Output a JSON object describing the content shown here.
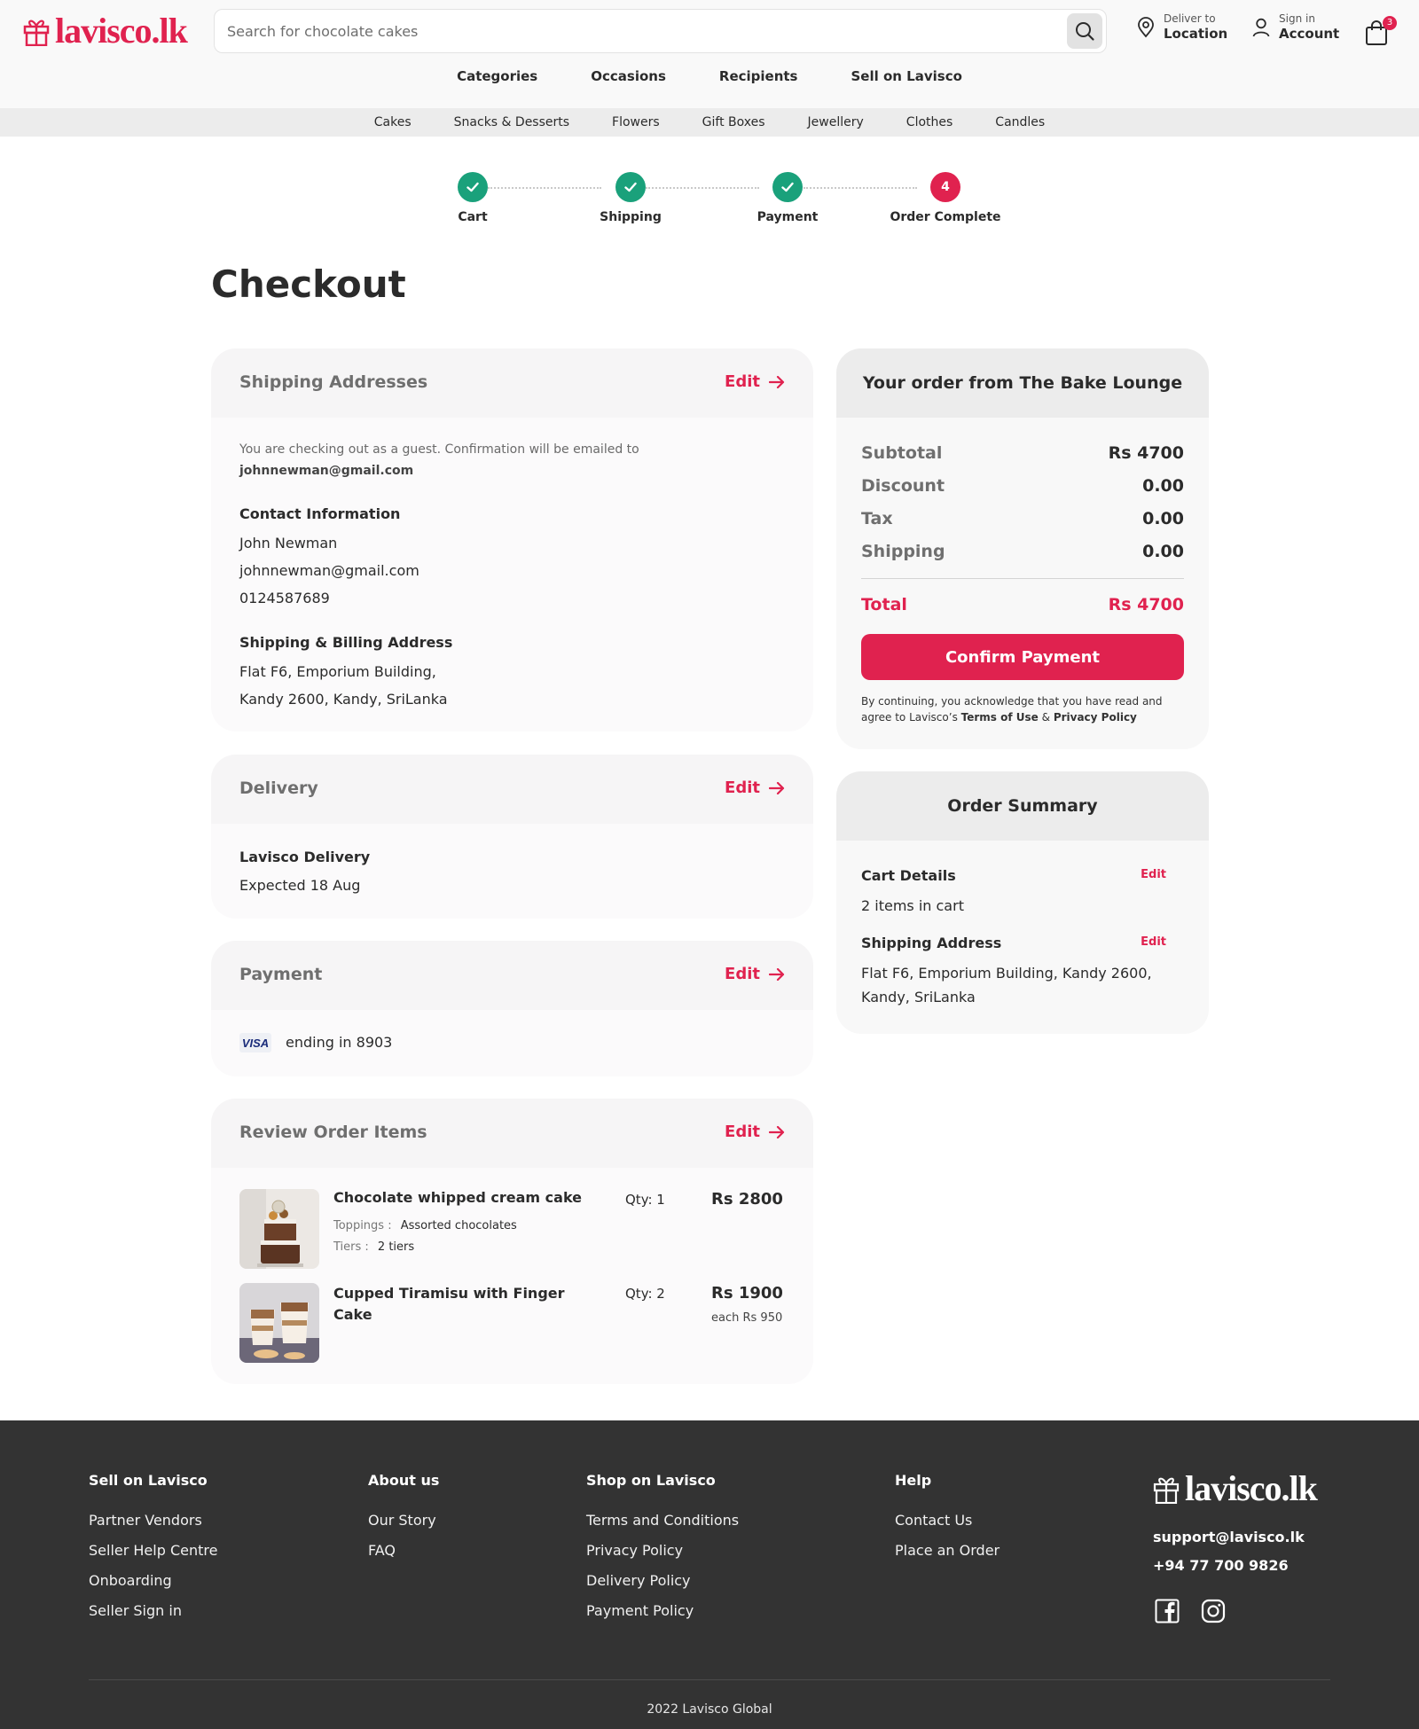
{
  "header": {
    "logo_text": "lavisco.lk",
    "search_placeholder": "Search for chocolate cakes",
    "deliver_small": "Deliver to",
    "deliver_big": "Location",
    "account_small": "Sign in",
    "account_big": "Account",
    "cart_count": "3"
  },
  "main_nav": [
    "Categories",
    "Occasions",
    "Recipients",
    "Sell on Lavisco"
  ],
  "sub_nav": [
    "Cakes",
    "Snacks & Desserts",
    "Flowers",
    "Gift Boxes",
    "Jewellery",
    "Clothes",
    "Candles"
  ],
  "steps": [
    {
      "label": "Cart",
      "state": "done"
    },
    {
      "label": "Shipping",
      "state": "done"
    },
    {
      "label": "Payment",
      "state": "done"
    },
    {
      "label": "Order Complete",
      "state": "current",
      "number": "4"
    }
  ],
  "page_title": "Checkout",
  "edit_label": "Edit",
  "shipping": {
    "title": "Shipping Addresses",
    "guest_note": "You are checking out as a guest. Confirmation will be emailed to",
    "guest_email": "johnnewman@gmail.com",
    "contact_label": "Contact Information",
    "name": "John Newman",
    "email": "johnnewman@gmail.com",
    "phone": "0124587689",
    "address_label": "Shipping & Billing Address",
    "address_line1": "Flat F6, Emporium Building,",
    "address_line2": "Kandy 2600, Kandy, SriLanka"
  },
  "delivery": {
    "title": "Delivery",
    "method": "Lavisco Delivery",
    "expected": "Expected 18 Aug"
  },
  "payment": {
    "title": "Payment",
    "card_brand": "VISA",
    "card_text": "ending in 8903"
  },
  "review": {
    "title": "Review Order Items",
    "items": [
      {
        "name": "Chocolate whipped cream cake",
        "qty": "Qty: 1",
        "price": "Rs 2800",
        "opt1_label": "Toppings :",
        "opt1_value": "Assorted chocolates",
        "opt2_label": "Tiers :",
        "opt2_value": "2 tiers"
      },
      {
        "name_line1": "Cupped Tiramisu with Finger",
        "name_line2": "Cake",
        "qty": "Qty: 2",
        "price": "Rs 1900",
        "each": "each Rs 950"
      }
    ]
  },
  "order": {
    "title": "Your order from The Bake Lounge",
    "subtotal_label": "Subtotal",
    "subtotal": "Rs 4700",
    "discount_label": "Discount",
    "discount": "0.00",
    "tax_label": "Tax",
    "tax": "0.00",
    "shipping_label": "Shipping",
    "shipping": "0.00",
    "total_label": "Total",
    "total": "Rs 4700",
    "confirm_label": "Confirm Payment",
    "legal_1": "By continuing, you acknowledge that you have read and",
    "legal_2": "agree to Lavisco’s",
    "terms": "Terms of Use",
    "amp": "&",
    "privacy": "Privacy Policy"
  },
  "summary": {
    "title": "Order Summary",
    "cart_label": "Cart Details",
    "cart_text": "2 items in cart",
    "address_label": "Shipping Address",
    "address_line1": "Flat F6, Emporium Building, Kandy 2600,",
    "address_line2": "Kandy, SriLanka"
  },
  "footer": {
    "col1_head": "Sell on Lavisco",
    "col1": [
      "Partner Vendors",
      "Seller Help Centre",
      "Onboarding",
      "Seller Sign in"
    ],
    "col2_head": "About us",
    "col2": [
      "Our Story",
      "FAQ"
    ],
    "col3_head": "Shop on Lavisco",
    "col3": [
      "Terms and Conditions",
      "Privacy Policy",
      "Delivery Policy",
      "Payment Policy"
    ],
    "col4_head": "Help",
    "col4": [
      "Contact Us",
      "Place an Order"
    ],
    "logo_text": "lavisco.lk",
    "email": "support@lavisco.lk",
    "phone": "+94 77 700 9826",
    "copyright": "2022 Lavisco Global"
  },
  "colors": {
    "brand": "#e0224f",
    "step_done": "#1aa17b",
    "footer_bg": "#333333"
  }
}
